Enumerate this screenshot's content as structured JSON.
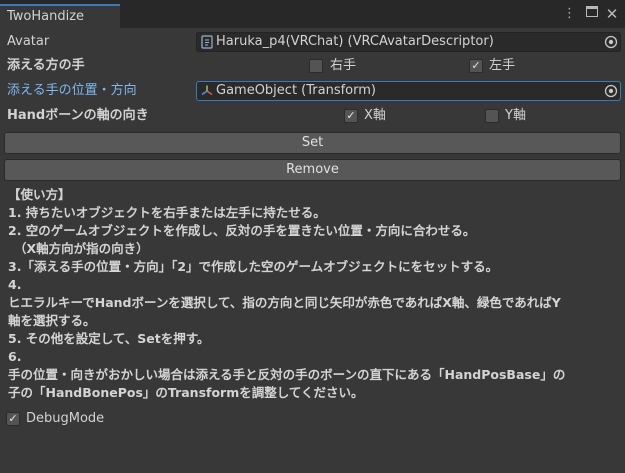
{
  "window": {
    "tab_title": "TwoHandize"
  },
  "avatar": {
    "label": "Avatar",
    "value": "Haruka_p4(VRChat) (VRCAvatarDescriptor)"
  },
  "hand": {
    "label": "添える方の手",
    "right_label": "右手",
    "right_checked": false,
    "left_label": "左手",
    "left_checked": true
  },
  "target": {
    "label": "添える手の位置・方向",
    "value": "GameObject (Transform)"
  },
  "axis": {
    "label": "Handボーンの軸の向き",
    "x_label": "X軸",
    "x_checked": true,
    "y_label": "Y軸",
    "y_checked": false
  },
  "buttons": {
    "set": "Set",
    "remove": "Remove"
  },
  "help": {
    "lines": [
      "【使い方】",
      "1. 持ちたいオブジェクトを右手または左手に持たせる。",
      "2. 空のゲームオブジェクトを作成し、反対の手を置きたい位置・方向に合わせる。",
      "（X軸方向が指の向き）",
      "3.「添える手の位置・方向」「2」で作成した空のゲームオブジェクトにをセットする。",
      "4.",
      "ヒエラルキーでHandボーンを選択して、指の方向と同じ矢印が赤色であればX軸、緑色であればY",
      "軸を選択する。",
      "5. その他を設定して、Setを押す。",
      "6.",
      "手の位置・向きがおかしい場合は添える手と反対の手のボーンの直下にある「HandPosBase」の",
      "子の「HandBonePos」のTransformを調整してください。"
    ]
  },
  "debug": {
    "label": "DebugMode",
    "checked": true
  }
}
